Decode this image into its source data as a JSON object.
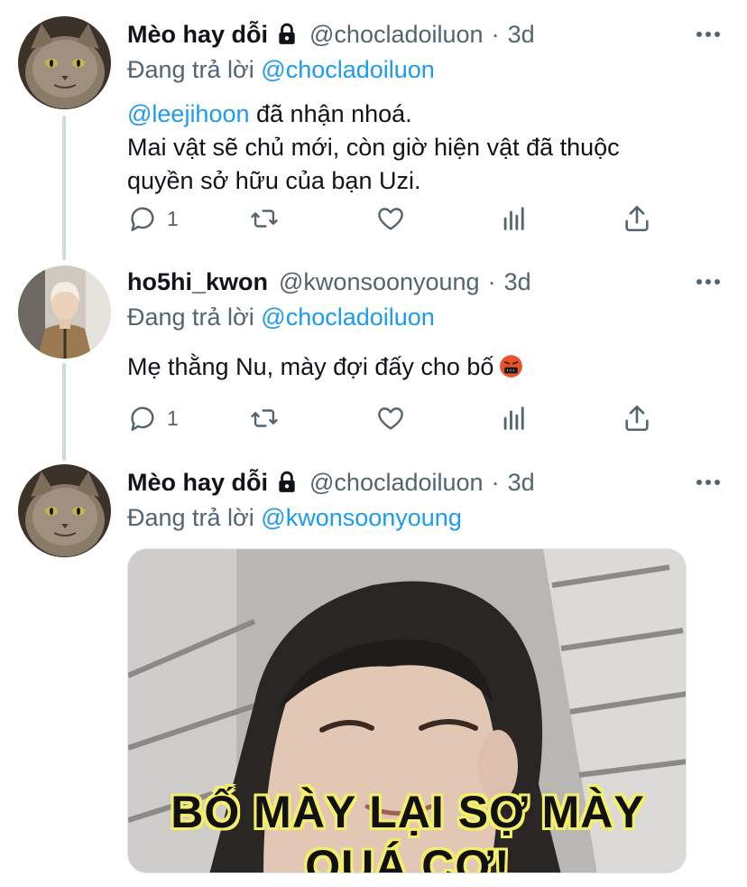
{
  "tweets": [
    {
      "display_name": "Mèo hay dỗi",
      "handle": "@chocladoiluon",
      "separator": "·",
      "time": "3d",
      "reply_prefix": "Đang trả lời",
      "reply_to": "@chocladoiluon",
      "mention": "@leejihoon",
      "line1_rest": " đã nhận nhoá.",
      "line2": "Mai vật sẽ chủ mới, còn giờ hiện vật đã thuộc",
      "line3": "quyền sở hữu của bạn Uzi.",
      "reply_count": "1",
      "protected": true
    },
    {
      "display_name": "ho5hi_kwon",
      "handle": "@kwonsoonyoung",
      "separator": "·",
      "time": "3d",
      "reply_prefix": "Đang trả lời",
      "reply_to": "@chocladoiluon",
      "text": "Mẹ thằng Nu, mày đợi đấy cho bố",
      "emoji": "angry-symbols-face-emoji",
      "reply_count": "1",
      "protected": false
    },
    {
      "display_name": "Mèo hay dỗi",
      "handle": "@chocladoiluon",
      "separator": "·",
      "time": "3d",
      "reply_prefix": "Đang trả lời",
      "reply_to": "@kwonsoonyoung",
      "media_caption_line1": "BỐ MÀY LẠI SỢ MÀY",
      "media_caption_line2": "QUÁ CƠ!",
      "protected": true
    }
  ],
  "icons": [
    "lock-icon",
    "more-icon",
    "reply-icon",
    "retweet-icon",
    "like-icon",
    "analytics-icon",
    "share-icon"
  ],
  "colors": {
    "link": "#1d9bf0",
    "secondary": "#536471",
    "text": "#0f1419",
    "thread_line": "#cfd9de",
    "caption_outline": "#f3ef6a"
  }
}
